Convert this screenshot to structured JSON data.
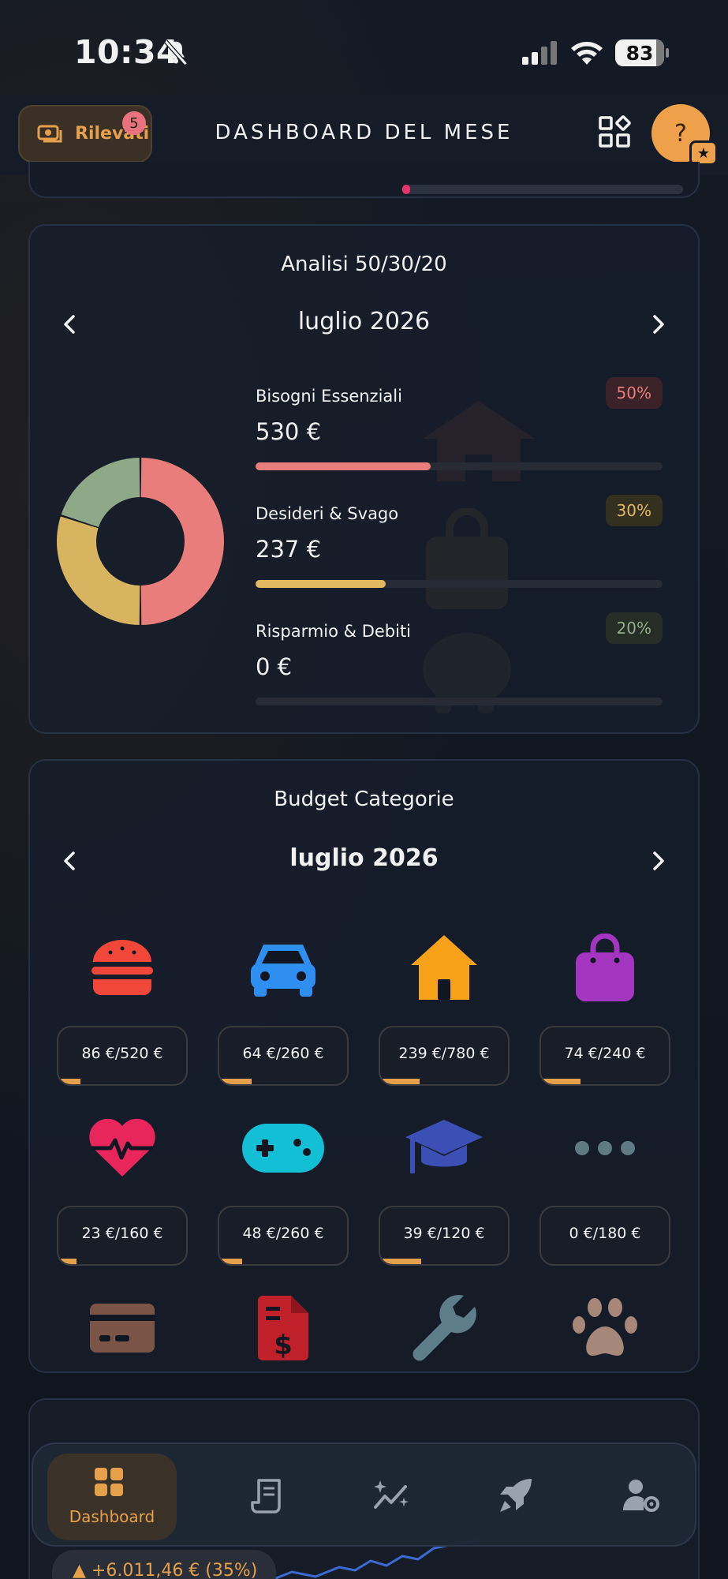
{
  "status_bar": {
    "time": "10:34",
    "battery": "83"
  },
  "header": {
    "rilevati_label": "Rilevati",
    "rilevati_badge": "5",
    "title": "DASHBOARD DEL MESE",
    "help_label": "?"
  },
  "analysis": {
    "title": "Analisi 50/30/20",
    "month": "luglio 2026",
    "rows": [
      {
        "name": "Bisogni Essenziali",
        "amount": "530 €",
        "pct": "50%",
        "progress": 0.43,
        "color": "#e97d7b",
        "pct_bg": "#3a2228",
        "pct_color": "#e97d7b"
      },
      {
        "name": "Desideri & Svago",
        "amount": "237 €",
        "pct": "30%",
        "progress": 0.32,
        "color": "#e2b862",
        "pct_bg": "#33301f",
        "pct_color": "#e2b862"
      },
      {
        "name": "Risparmio & Debiti",
        "amount": "0 €",
        "pct": "20%",
        "progress": 0.0,
        "color": "#8fad89",
        "pct_bg": "#252d26",
        "pct_color": "#8fad89"
      }
    ],
    "donut": [
      {
        "label": "Bisogni Essenziali",
        "value": 50,
        "color": "#e97d7b"
      },
      {
        "label": "Desideri & Svago",
        "value": 30,
        "color": "#d8b460"
      },
      {
        "label": "Risparmio & Debiti",
        "value": 20,
        "color": "#8fa888"
      }
    ]
  },
  "budget": {
    "title": "Budget Categorie",
    "month": "luglio 2026",
    "items": [
      {
        "icon": "burger-icon",
        "label": "86 €/520 €",
        "progress": 0.17
      },
      {
        "icon": "car-icon",
        "label": "64 €/260 €",
        "progress": 0.25
      },
      {
        "icon": "house-icon",
        "label": "239 €/780 €",
        "progress": 0.31
      },
      {
        "icon": "shopping-bag-icon",
        "label": "74 €/240 €",
        "progress": 0.31
      },
      {
        "icon": "heart-pulse-icon",
        "label": "23 €/160 €",
        "progress": 0.14
      },
      {
        "icon": "gamepad-icon",
        "label": "48 €/260 €",
        "progress": 0.18
      },
      {
        "icon": "graduation-cap-icon",
        "label": "39 €/120 €",
        "progress": 0.32
      },
      {
        "icon": "more-dots-icon",
        "label": "0 €/180 €",
        "progress": 0.0
      },
      {
        "icon": "credit-card-icon",
        "label": "",
        "progress": 0
      },
      {
        "icon": "invoice-dollar-icon",
        "label": "",
        "progress": 0
      },
      {
        "icon": "wrench-icon",
        "label": "",
        "progress": 0
      },
      {
        "icon": "paw-icon",
        "label": "",
        "progress": 0
      }
    ]
  },
  "bottom_nav": {
    "active_label": "Dashboard",
    "items": [
      "dashboard-icon",
      "receipt-icon",
      "sparkle-chart-icon",
      "rocket-icon",
      "user-settings-icon"
    ]
  },
  "performance_pill": "▲ +6.011,46 € (35%)",
  "colors": {
    "accent": "#e4a04a",
    "background": "#111722"
  }
}
